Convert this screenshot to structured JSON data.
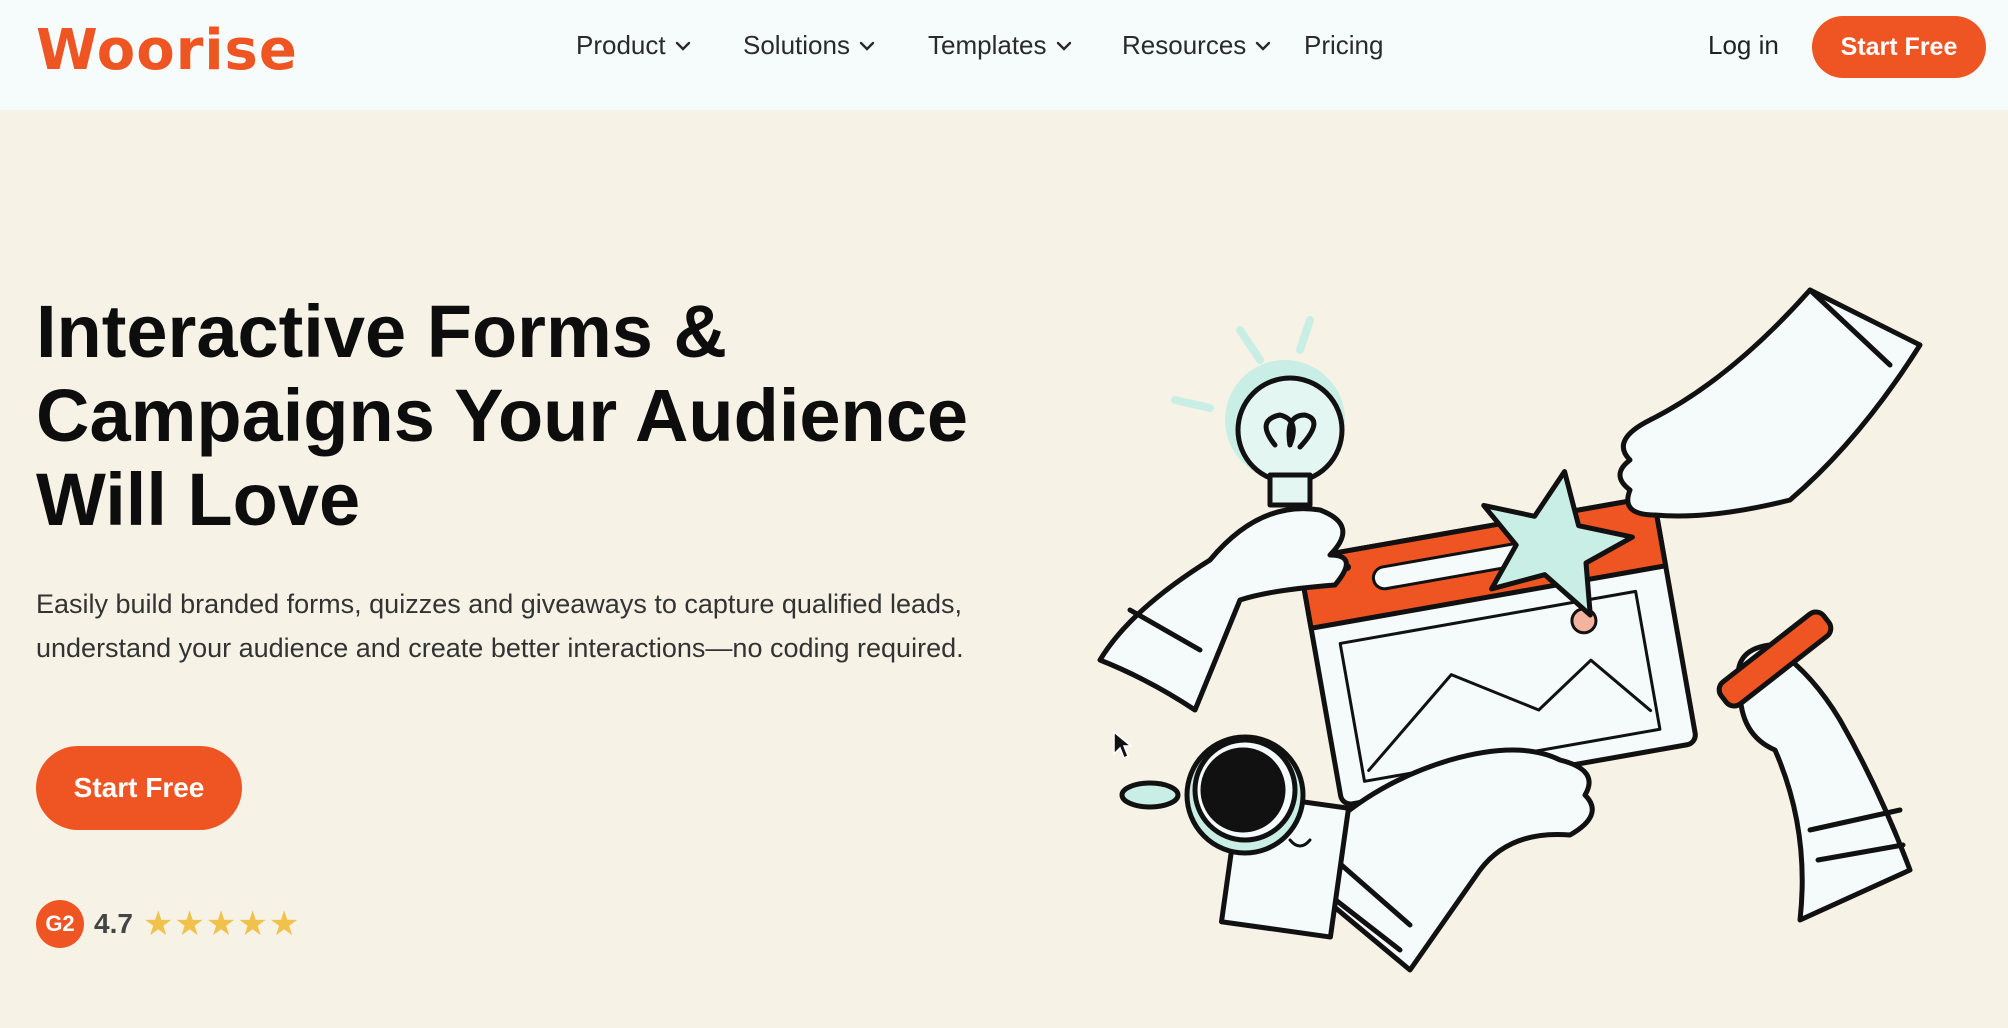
{
  "brand": {
    "name": "Woorise",
    "accent": "#ef5423"
  },
  "nav": {
    "items": [
      {
        "label": "Product",
        "dropdown": true
      },
      {
        "label": "Solutions",
        "dropdown": true
      },
      {
        "label": "Templates",
        "dropdown": true
      },
      {
        "label": "Resources",
        "dropdown": true
      },
      {
        "label": "Pricing",
        "dropdown": false
      }
    ],
    "login_label": "Log in",
    "start_label": "Start Free"
  },
  "hero": {
    "title_lines": [
      "Interactive Forms &",
      "Campaigns Your Audience",
      "Will Love"
    ],
    "subtitle": "Easily build branded forms, quizzes and giveaways to capture qualified leads, understand your audience and create better interactions—no coding required.",
    "cta_label": "Start Free"
  },
  "rating": {
    "badge": "G2",
    "value": "4.7",
    "stars": "★★★★★",
    "star_color": "#f0c24b"
  }
}
